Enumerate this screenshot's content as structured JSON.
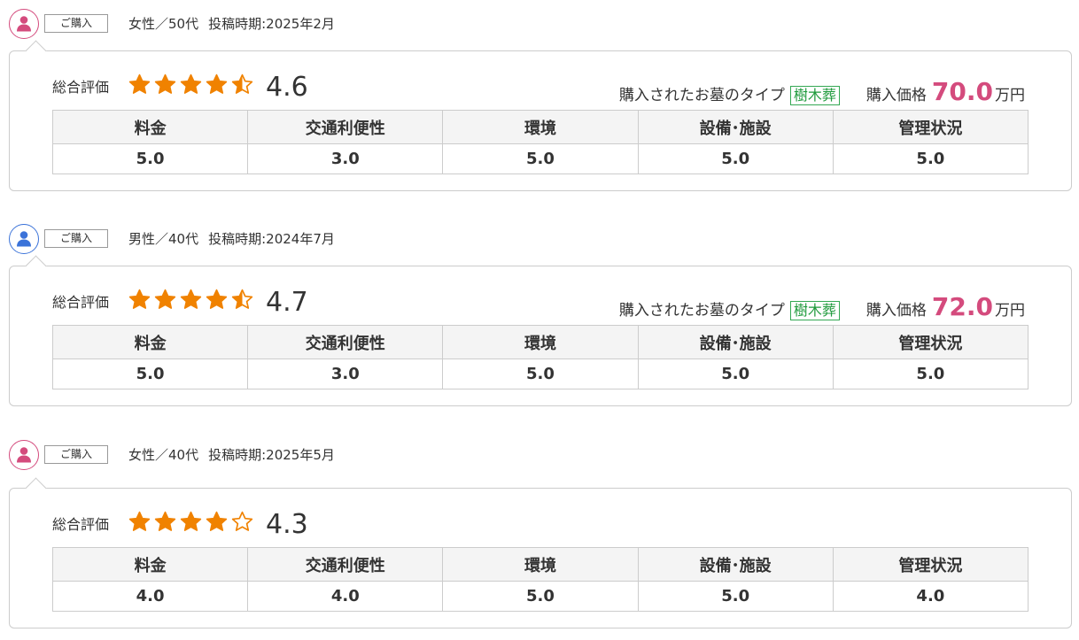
{
  "colors": {
    "accent_pink": "#d44b7d",
    "accent_blue": "#3b73d9",
    "star": "#f08200",
    "tag_green": "#34a853"
  },
  "reviews": [
    {
      "avatar_icon": "female-user-icon",
      "avatar_color": "#d44b7d",
      "badge": "ご購入",
      "demographic": "女性／50代",
      "posted": "投稿時期:2025年2月",
      "overall_label": "総合評価",
      "overall_score": "4.6",
      "stars": [
        "full",
        "full",
        "full",
        "full",
        "half"
      ],
      "grave_type_label": "購入されたお墓のタイプ",
      "grave_type": "樹木葬",
      "price_label": "購入価格",
      "price_value": "70.0",
      "price_unit": "万円",
      "categories": [
        "料金",
        "交通利便性",
        "環境",
        "設備･施設",
        "管理状況"
      ],
      "scores": [
        "5.0",
        "3.0",
        "5.0",
        "5.0",
        "5.0"
      ]
    },
    {
      "avatar_icon": "male-user-icon",
      "avatar_color": "#3b73d9",
      "badge": "ご購入",
      "demographic": "男性／40代",
      "posted": "投稿時期:2024年7月",
      "overall_label": "総合評価",
      "overall_score": "4.7",
      "stars": [
        "full",
        "full",
        "full",
        "full",
        "half"
      ],
      "grave_type_label": "購入されたお墓のタイプ",
      "grave_type": "樹木葬",
      "price_label": "購入価格",
      "price_value": "72.0",
      "price_unit": "万円",
      "categories": [
        "料金",
        "交通利便性",
        "環境",
        "設備･施設",
        "管理状況"
      ],
      "scores": [
        "5.0",
        "3.0",
        "5.0",
        "5.0",
        "5.0"
      ]
    },
    {
      "avatar_icon": "female-user-icon",
      "avatar_color": "#d44b7d",
      "badge": "ご購入",
      "demographic": "女性／40代",
      "posted": "投稿時期:2025年5月",
      "overall_label": "総合評価",
      "overall_score": "4.3",
      "stars": [
        "full",
        "full",
        "full",
        "full",
        "empty"
      ],
      "categories": [
        "料金",
        "交通利便性",
        "環境",
        "設備･施設",
        "管理状況"
      ],
      "scores": [
        "4.0",
        "4.0",
        "5.0",
        "5.0",
        "4.0"
      ]
    }
  ]
}
